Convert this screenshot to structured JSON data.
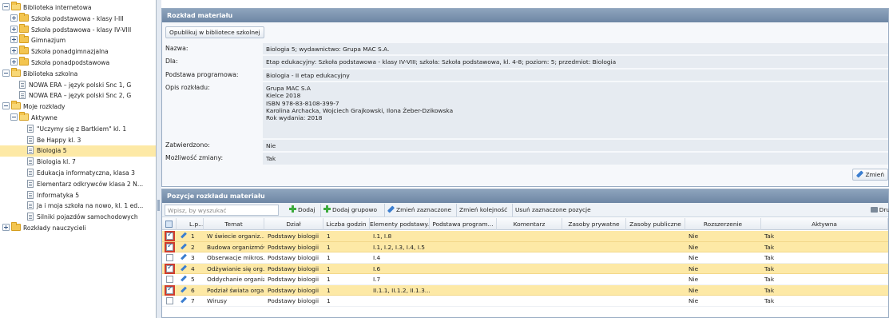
{
  "tree": [
    {
      "label": "Biblioteka internetowa",
      "depth": 0,
      "kind": "folder-open"
    },
    {
      "label": "Szkoła podstawowa - klasy I-III",
      "depth": 1,
      "kind": "folder"
    },
    {
      "label": "Szkoła podstawowa - klasy IV-VIII",
      "depth": 1,
      "kind": "folder"
    },
    {
      "label": "Gimnazjum",
      "depth": 1,
      "kind": "folder"
    },
    {
      "label": "Szkoła ponadgimnazjalna",
      "depth": 1,
      "kind": "folder"
    },
    {
      "label": "Szkoła ponadpodstawowa",
      "depth": 1,
      "kind": "folder"
    },
    {
      "label": "Biblioteka szkolna",
      "depth": 0,
      "kind": "folder-open"
    },
    {
      "label": "NOWA ERA – język polski Snc 1, G",
      "depth": 1,
      "kind": "doc"
    },
    {
      "label": "NOWA ERA – język polski Snc 2, G",
      "depth": 1,
      "kind": "doc"
    },
    {
      "label": "Moje rozkłady",
      "depth": 0,
      "kind": "folder-open"
    },
    {
      "label": "Aktywne",
      "depth": 1,
      "kind": "folder-open"
    },
    {
      "label": "\"Uczymy się z Bartkiem\" kl. 1",
      "depth": 2,
      "kind": "doc"
    },
    {
      "label": "Be Happy kl. 3",
      "depth": 2,
      "kind": "doc"
    },
    {
      "label": "Biologia 5",
      "depth": 2,
      "kind": "doc",
      "selected": true
    },
    {
      "label": "Biologia kl. 7",
      "depth": 2,
      "kind": "doc"
    },
    {
      "label": "Edukacja informatyczna, klasa 3",
      "depth": 2,
      "kind": "doc"
    },
    {
      "label": "Elementarz odkrywców klasa 2 N...",
      "depth": 2,
      "kind": "doc"
    },
    {
      "label": "Informatyka 5",
      "depth": 2,
      "kind": "doc"
    },
    {
      "label": "Ja i moja szkoła na nowo, kl. 1 ed...",
      "depth": 2,
      "kind": "doc"
    },
    {
      "label": "Silniki pojazdów samochodowych",
      "depth": 2,
      "kind": "doc"
    },
    {
      "label": "Rozkłady nauczycieli",
      "depth": 0,
      "kind": "folder"
    }
  ],
  "details": {
    "header": "Rozkład materiału",
    "publish_button": "Opublikuj w bibliotece szkolnej",
    "fields": {
      "nazwa_label": "Nazwa:",
      "nazwa": "Biologia 5; wydawnictwo: Grupa MAC S.A.",
      "dla_label": "Dla:",
      "dla": "Etap edukacyjny: Szkoła podstawowa - klasy IV-VIII; szkoła: Szkoła podstawowa, kl. 4-8; poziom: 5; przedmiot: Biologia",
      "podstawa_label": "Podstawa programowa:",
      "podstawa": "Biologia - II etap edukacyjny",
      "opis_label": "Opis rozkładu:",
      "opis_lines": [
        "Grupa MAC S.A",
        "Kielce 2018",
        "ISBN 978-83-8108-399-7",
        "Karolina Archacka, Wojciech Grajkowski, Ilona Żeber-Dzikowska",
        "Rok wydania: 2018"
      ],
      "zatw_label": "Zatwierdzono:",
      "zatw": "Nie",
      "mozl_label": "Możliwość zmiany:",
      "mozl": "Tak"
    },
    "change_button": "Zmień"
  },
  "grid": {
    "header": "Pozycje rozkładu materiału",
    "search_placeholder": "Wpisz, by wyszukać",
    "toolbar": {
      "add": "Dodaj",
      "add_group": "Dodaj grupowo",
      "edit_selected": "Zmień zaznaczone",
      "reorder": "Zmień kolejność",
      "delete_selected": "Usuń zaznaczone pozycje",
      "print": "Drukuj"
    },
    "columns": [
      "L.p...",
      "Temat",
      "Dział",
      "Liczba godzin",
      "Elementy podstawy...",
      "Podstawa program...",
      "Komentarz",
      "Zasoby prywatne",
      "Zasoby publiczne",
      "Rozszerzenie",
      "Aktywna"
    ],
    "sort_indicator": "^",
    "rows": [
      {
        "checked": true,
        "lp": "1",
        "temat": "W świecie organiz...",
        "dzial": "Podstawy biologii",
        "godz": "1",
        "elem": "I.1, I.8",
        "pp": "",
        "kom": "",
        "zp": "",
        "zpub": "",
        "rozsz": "Nie",
        "akt": "Tak",
        "hl": true
      },
      {
        "checked": true,
        "lp": "2",
        "temat": "Budowa organizmów",
        "dzial": "Podstawy biologii",
        "godz": "1",
        "elem": "I.1, I.2, I.3, I.4, I.5",
        "pp": "",
        "kom": "",
        "zp": "",
        "zpub": "",
        "rozsz": "Nie",
        "akt": "Tak",
        "hl": true
      },
      {
        "checked": false,
        "lp": "3",
        "temat": "Obserwacje mikros...",
        "dzial": "Podstawy biologii",
        "godz": "1",
        "elem": "I.4",
        "pp": "",
        "kom": "",
        "zp": "",
        "zpub": "",
        "rozsz": "Nie",
        "akt": "Tak",
        "hl": false
      },
      {
        "checked": true,
        "lp": "4",
        "temat": "Odżywianie się org...",
        "dzial": "Podstawy biologii",
        "godz": "1",
        "elem": "I.6",
        "pp": "",
        "kom": "",
        "zp": "",
        "zpub": "",
        "rozsz": "Nie",
        "akt": "Tak",
        "hl": true
      },
      {
        "checked": false,
        "lp": "5",
        "temat": "Oddychanie organiz...",
        "dzial": "Podstawy biologii",
        "godz": "1",
        "elem": "I.7",
        "pp": "",
        "kom": "",
        "zp": "",
        "zpub": "",
        "rozsz": "Nie",
        "akt": "Tak",
        "hl": false
      },
      {
        "checked": true,
        "lp": "6",
        "temat": "Podział świata orga...",
        "dzial": "Podstawy biologii",
        "godz": "1",
        "elem": "II.1.1, II.1.2, II.1.3...",
        "pp": "",
        "kom": "",
        "zp": "",
        "zpub": "",
        "rozsz": "Nie",
        "akt": "Tak",
        "hl": true
      },
      {
        "checked": false,
        "lp": "7",
        "temat": "Wirusy",
        "dzial": "Podstawy biologii",
        "godz": "1",
        "elem": "",
        "pp": "",
        "kom": "",
        "zp": "",
        "zpub": "",
        "rozsz": "Nie",
        "akt": "Tak",
        "hl": false
      }
    ]
  }
}
